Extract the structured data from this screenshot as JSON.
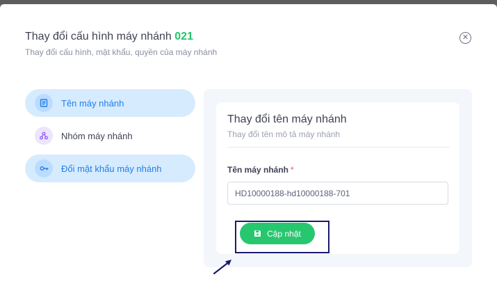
{
  "modal": {
    "title": "Thay đổi cấu hình máy nhánh",
    "title_code": "021",
    "subtitle": "Thay đổi cấu hình, mật khẩu, quyền của máy nhánh"
  },
  "nav": {
    "items": [
      {
        "label": "Tên máy nhánh",
        "icon": "document-icon",
        "active": true
      },
      {
        "label": "Nhóm máy nhánh",
        "icon": "group-icon",
        "active": false
      },
      {
        "label": "Đổi mật khẩu máy nhánh",
        "icon": "key-icon",
        "active": true
      }
    ]
  },
  "card": {
    "title": "Thay đổi tên máy nhánh",
    "subtitle": "Thay đổi tên mô tả máy nhánh",
    "field_label": "Tên máy nhánh",
    "required_mark": "*",
    "field_value": "HD10000188-hd10000188-701",
    "update_label": "Cập nhật"
  },
  "colors": {
    "accent": "#1e7fe8",
    "success": "#27c76f",
    "highlight": "#1c1970"
  }
}
